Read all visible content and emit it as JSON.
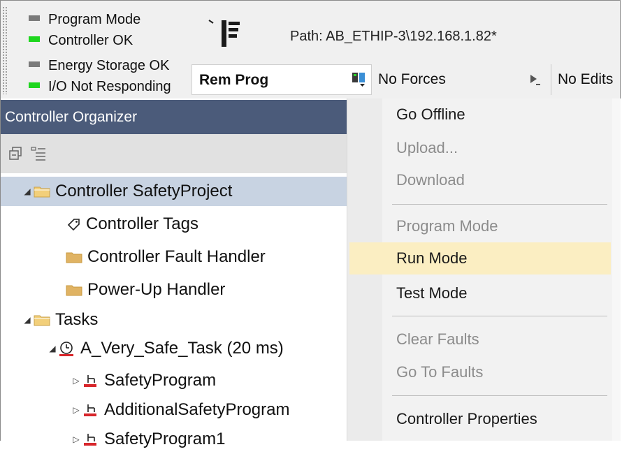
{
  "status_indicators": [
    {
      "label": "Program Mode",
      "led": "gray"
    },
    {
      "label": "Controller OK",
      "led": "green"
    },
    {
      "label": "Energy Storage OK",
      "led": "gray"
    },
    {
      "label": "I/O Not Responding",
      "led": "green"
    }
  ],
  "path": "Path: AB_ETHIP-3\\192.168.1.82*",
  "mode_dropdown": {
    "label": "Rem Prog",
    "icon": "controller-mode-icon"
  },
  "forces_dropdown": {
    "label": "No Forces",
    "icon": "play-arrow-icon"
  },
  "edits_label": "No Edits",
  "organizer": {
    "title": "Controller Organizer",
    "toolbar_icons": [
      "collapse-all-icon",
      "show-list-icon"
    ],
    "tree": [
      {
        "label": "Controller SafetyProject",
        "icon": "folder-icon",
        "expander": "◢",
        "level": 0,
        "selected": true
      },
      {
        "label": "Controller Tags",
        "icon": "tag-icon",
        "expander": "",
        "level": 1
      },
      {
        "label": "Controller Fault Handler",
        "icon": "folder-icon",
        "expander": "",
        "level": 1
      },
      {
        "label": "Power-Up Handler",
        "icon": "folder-icon",
        "expander": "",
        "level": 1
      },
      {
        "label": "Tasks",
        "icon": "folder-icon",
        "expander": "◢",
        "level": 0
      },
      {
        "label": "A_Very_Safe_Task (20 ms)",
        "icon": "periodic-task-icon",
        "expander": "◢",
        "level": 1
      },
      {
        "label": "SafetyProgram",
        "icon": "safety-program-icon",
        "expander": "▷",
        "level": 2
      },
      {
        "label": "AdditionalSafetyProgram",
        "icon": "safety-program-icon",
        "expander": "▷",
        "level": 2
      },
      {
        "label": "SafetyProgram1",
        "icon": "safety-program-icon",
        "expander": "▷",
        "level": 2
      }
    ]
  },
  "menu": {
    "items": [
      {
        "label": "Go Offline",
        "enabled": true
      },
      {
        "label": "Upload...",
        "enabled": false
      },
      {
        "label": "Download",
        "enabled": false
      },
      {
        "label": "Program Mode",
        "enabled": false
      },
      {
        "label": "Run Mode",
        "enabled": true,
        "highlighted": true
      },
      {
        "label": "Test Mode",
        "enabled": true
      },
      {
        "label": "Clear Faults",
        "enabled": false
      },
      {
        "label": "Go To Faults",
        "enabled": false
      },
      {
        "label": "Controller Properties",
        "enabled": true
      }
    ]
  },
  "colors": {
    "organizer_header": "#4b5b7a",
    "menu_highlight": "#fbeec2",
    "tree_selected": "#c8d3e2",
    "led_green": "#1ed61e",
    "safety_red": "#d8262b"
  }
}
